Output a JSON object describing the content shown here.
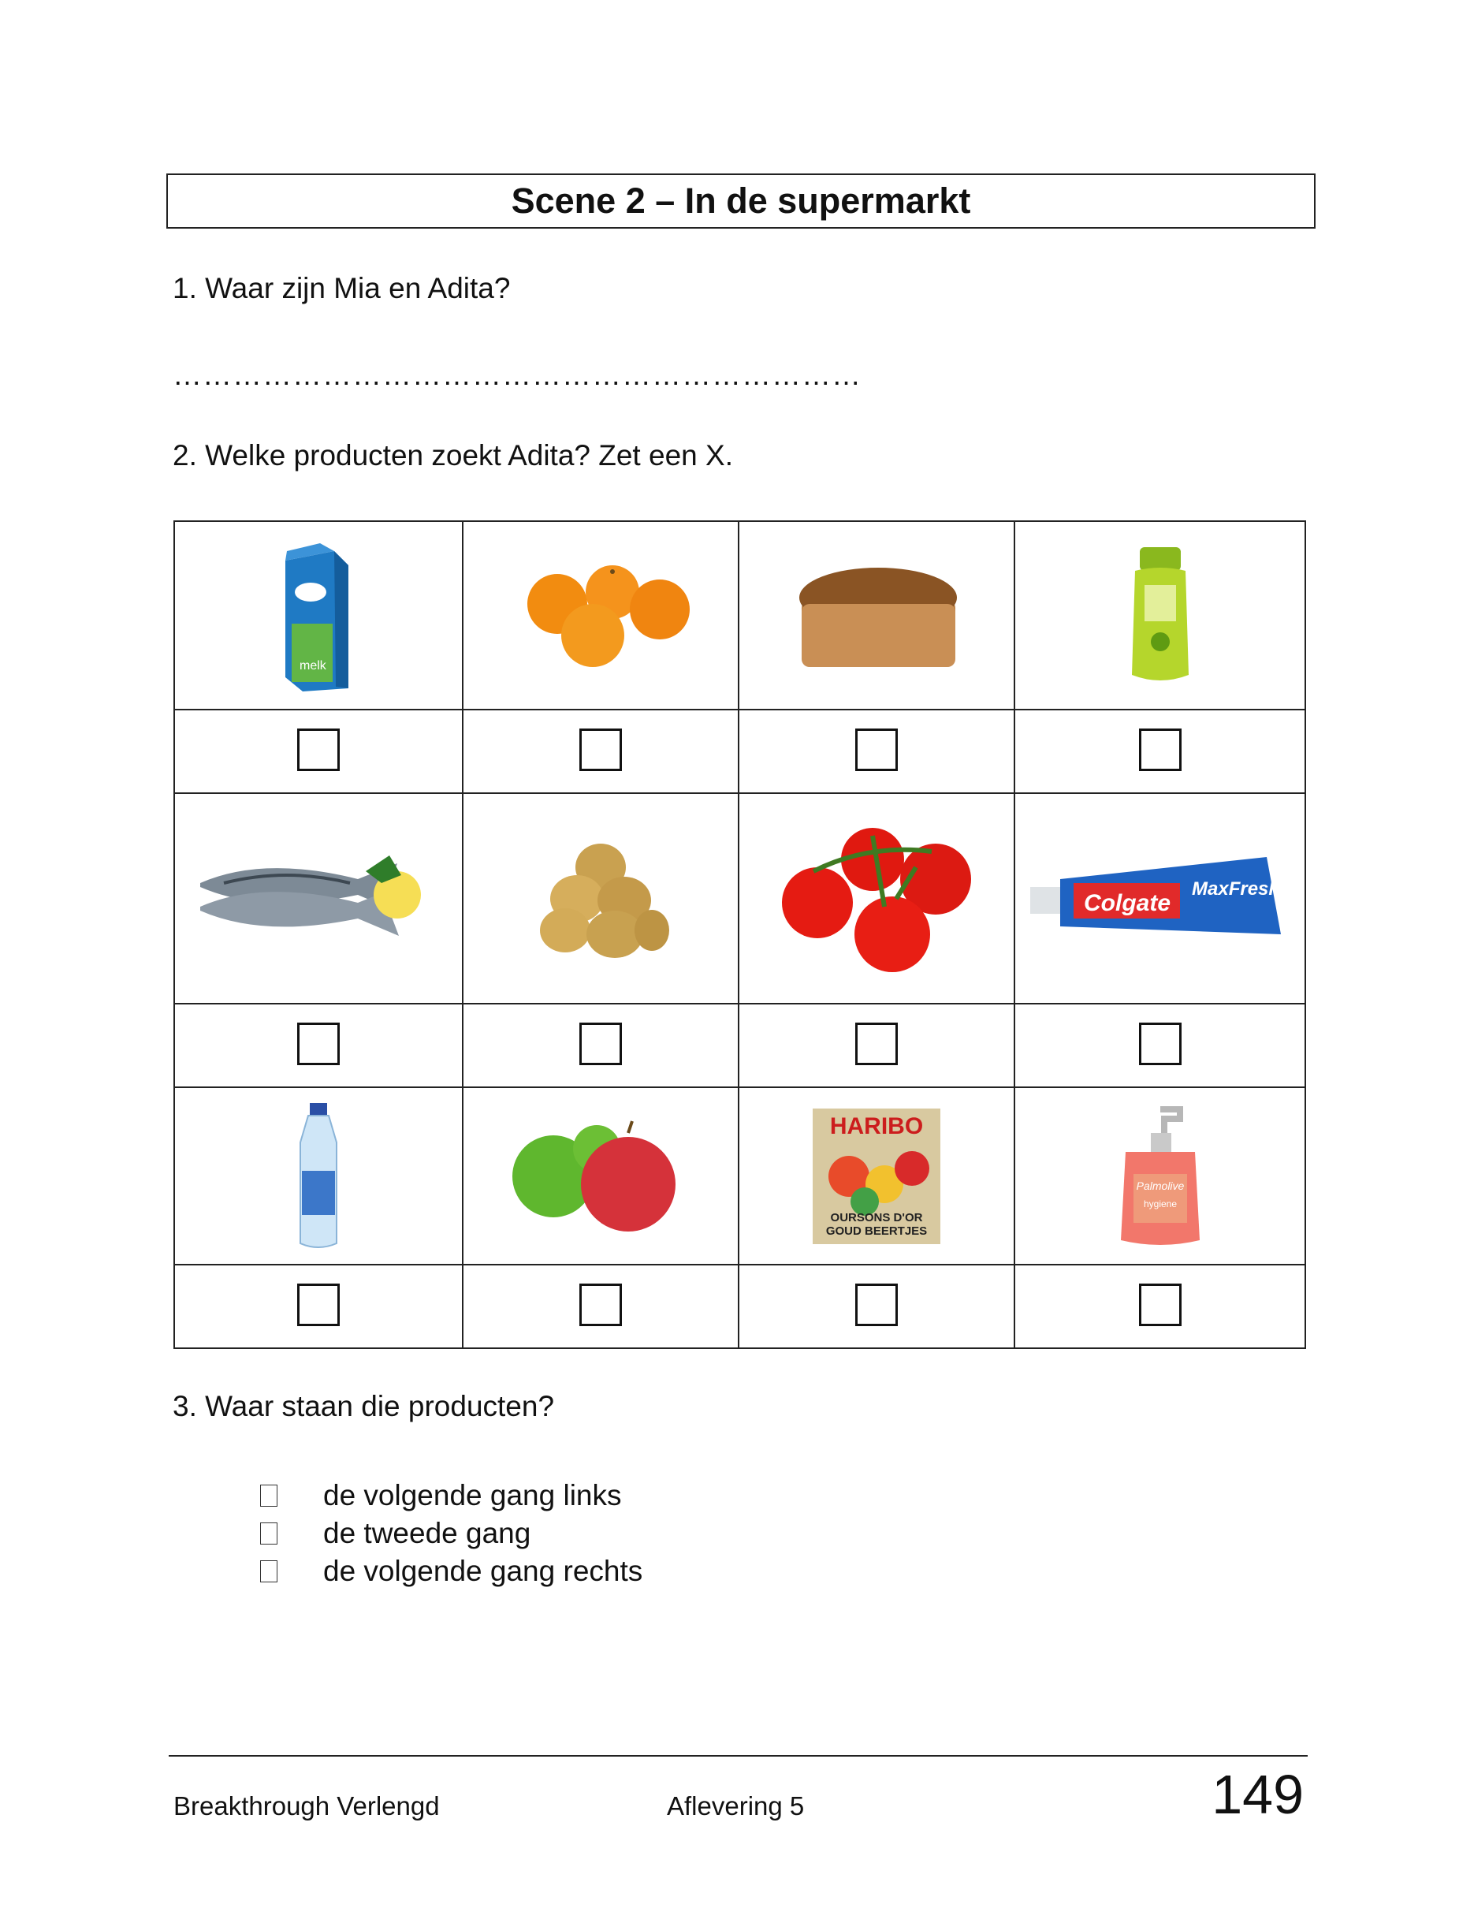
{
  "title": "Scene 2 – In de supermarkt",
  "questions": {
    "q1": "1. Waar zijn Mia en Adita?",
    "q1_answer_line": "……………………………………………………………",
    "q2": "2. Welke producten zoekt Adita? Zet een X.",
    "q3": "3. Waar staan die producten?"
  },
  "products": {
    "milk": {
      "label": "melk"
    },
    "colgate": {
      "brand": "Colgate",
      "variant": "MaxFresh"
    },
    "haribo": {
      "brand": "HARIBO",
      "label": "OURSONS D'OR GOUD BEERTJES"
    },
    "palmolive": {
      "brand": "Palmolive",
      "label": "hygiene"
    }
  },
  "options": [
    "de volgende gang links",
    "de tweede gang",
    "de volgende gang rechts"
  ],
  "footer": {
    "left": "Breakthrough Verlengd",
    "center": "Aflevering 5",
    "page_number": "149"
  }
}
